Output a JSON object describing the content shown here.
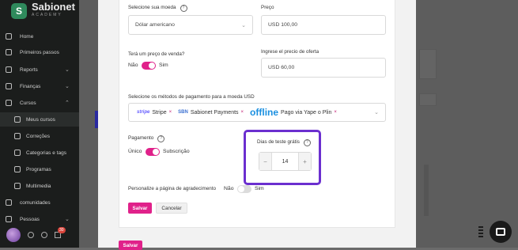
{
  "sidebar": {
    "brand_name": "Sabionet",
    "brand_sub": "ACADEMY",
    "items": [
      {
        "label": "Home",
        "icon": "home-icon",
        "chevron": ""
      },
      {
        "label": "Primeiros passos",
        "icon": "rocket-icon",
        "chevron": ""
      },
      {
        "label": "Reports",
        "icon": "reports-icon",
        "chevron": "⌄"
      },
      {
        "label": "Finanças",
        "icon": "finance-icon",
        "chevron": "⌄"
      },
      {
        "label": "Cursos",
        "icon": "courses-icon",
        "chevron": "⌃"
      },
      {
        "label": "Meus cursos",
        "icon": "my-courses-icon",
        "chevron": ""
      },
      {
        "label": "Correções",
        "icon": "corrections-icon",
        "chevron": ""
      },
      {
        "label": "Categorias e tags",
        "icon": "tags-icon",
        "chevron": ""
      },
      {
        "label": "Programas",
        "icon": "programs-icon",
        "chevron": ""
      },
      {
        "label": "Multimedia",
        "icon": "media-icon",
        "chevron": ""
      },
      {
        "label": "comunidades",
        "icon": "community-icon",
        "chevron": ""
      },
      {
        "label": "Pessoas",
        "icon": "people-icon",
        "chevron": "⌄"
      }
    ],
    "notification_count": "30"
  },
  "form": {
    "currency_label": "Selecione sua moeda",
    "currency_value": "Dólar americano",
    "price_label": "Preço",
    "price_value": "USD 100,00",
    "sale_price_label": "Terá um preço de venda?",
    "no": "Não",
    "yes": "Sim",
    "offer_label": "Ingrese el precio de oferta",
    "offer_value": "USD 60,00",
    "methods_label": "Selecione os métodos de pagamento para a moeda USD",
    "methods": [
      {
        "logo": "stripe",
        "label": "Stripe",
        "remove": "×"
      },
      {
        "logo": "SBN",
        "label": "Sabionet Payments",
        "remove": "×"
      },
      {
        "logo": "offline",
        "label": "Pago via Yape o Plin",
        "remove": "×"
      }
    ],
    "payment_label": "Pagamento",
    "payment_single": "Único",
    "payment_subscription": "Subscrição",
    "trial_label": "Dias de teste grátis",
    "trial_value": "14",
    "thankyou_label": "Personalize a página de agradecimento",
    "thankyou_no": "Não",
    "thankyou_yes": "Sim",
    "save": "Salvar",
    "cancel": "Cancelar",
    "save_bottom": "Salvar"
  },
  "colors": {
    "accent": "#e0218a",
    "highlight": "#6b2fcf",
    "sidebar": "#1b1d1c"
  }
}
